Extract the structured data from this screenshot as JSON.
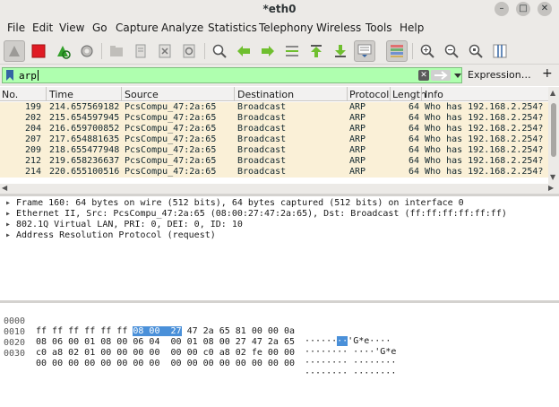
{
  "window": {
    "title": "*eth0"
  },
  "menu": [
    "File",
    "Edit",
    "View",
    "Go",
    "Capture",
    "Analyze",
    "Statistics",
    "Telephony",
    "Wireless",
    "Tools",
    "Help"
  ],
  "filter": {
    "value": "arp",
    "expression_label": "Expression…",
    "plus_label": "+"
  },
  "packet_list": {
    "columns": [
      "No.",
      "Time",
      "Source",
      "Destination",
      "Protocol",
      "Length",
      "Info"
    ],
    "rows": [
      [
        "199",
        "214.657569182",
        "PcsCompu_47:2a:65",
        "Broadcast",
        "ARP",
        "64",
        "Who has 192.168.2.254?"
      ],
      [
        "202",
        "215.654597945",
        "PcsCompu_47:2a:65",
        "Broadcast",
        "ARP",
        "64",
        "Who has 192.168.2.254?"
      ],
      [
        "204",
        "216.659700852",
        "PcsCompu_47:2a:65",
        "Broadcast",
        "ARP",
        "64",
        "Who has 192.168.2.254?"
      ],
      [
        "207",
        "217.654881635",
        "PcsCompu_47:2a:65",
        "Broadcast",
        "ARP",
        "64",
        "Who has 192.168.2.254?"
      ],
      [
        "209",
        "218.655477948",
        "PcsCompu_47:2a:65",
        "Broadcast",
        "ARP",
        "64",
        "Who has 192.168.2.254?"
      ],
      [
        "212",
        "219.658236637",
        "PcsCompu_47:2a:65",
        "Broadcast",
        "ARP",
        "64",
        "Who has 192.168.2.254?"
      ],
      [
        "214",
        "220.655100516",
        "PcsCompu_47:2a:65",
        "Broadcast",
        "ARP",
        "64",
        "Who has 192.168.2.254?"
      ]
    ]
  },
  "details": [
    "Frame 160: 64 bytes on wire (512 bits), 64 bytes captured (512 bits) on interface 0",
    "Ethernet II, Src: PcsCompu_47:2a:65 (08:00:27:47:2a:65), Dst: Broadcast (ff:ff:ff:ff:ff:ff)",
    "802.1Q Virtual LAN, PRI: 0, DEI: 0, ID: 10",
    "Address Resolution Protocol (request)"
  ],
  "bytes": [
    {
      "offset": "0000",
      "hex_pre": "ff ff ff ff ff ff ",
      "hex_hl": "08 00  27",
      "hex_post": " 47 2a 65 81 00 00 0a",
      "ascii_pre": "······",
      "ascii_hl": "··",
      "ascii_post": "'G*e····"
    },
    {
      "offset": "0010",
      "hex_pre": "08 06 00 01 08 00 06 04  00 01 08 00 27 47 2a 65",
      "hex_hl": "",
      "hex_post": "",
      "ascii_pre": "········ ····'G*e",
      "ascii_hl": "",
      "ascii_post": ""
    },
    {
      "offset": "0020",
      "hex_pre": "c0 a8 02 01 00 00 00 00  00 00 c0 a8 02 fe 00 00",
      "hex_hl": "",
      "hex_post": "",
      "ascii_pre": "········ ········",
      "ascii_hl": "",
      "ascii_post": ""
    },
    {
      "offset": "0030",
      "hex_pre": "00 00 00 00 00 00 00 00  00 00 00 00 00 00 00 00",
      "hex_hl": "",
      "hex_post": "",
      "ascii_pre": "········ ········",
      "ascii_hl": "",
      "ascii_post": ""
    }
  ],
  "colors": {
    "filter_valid": "#afffaf",
    "arp_row": "#faf0d7",
    "selection": "#4a90d9"
  }
}
